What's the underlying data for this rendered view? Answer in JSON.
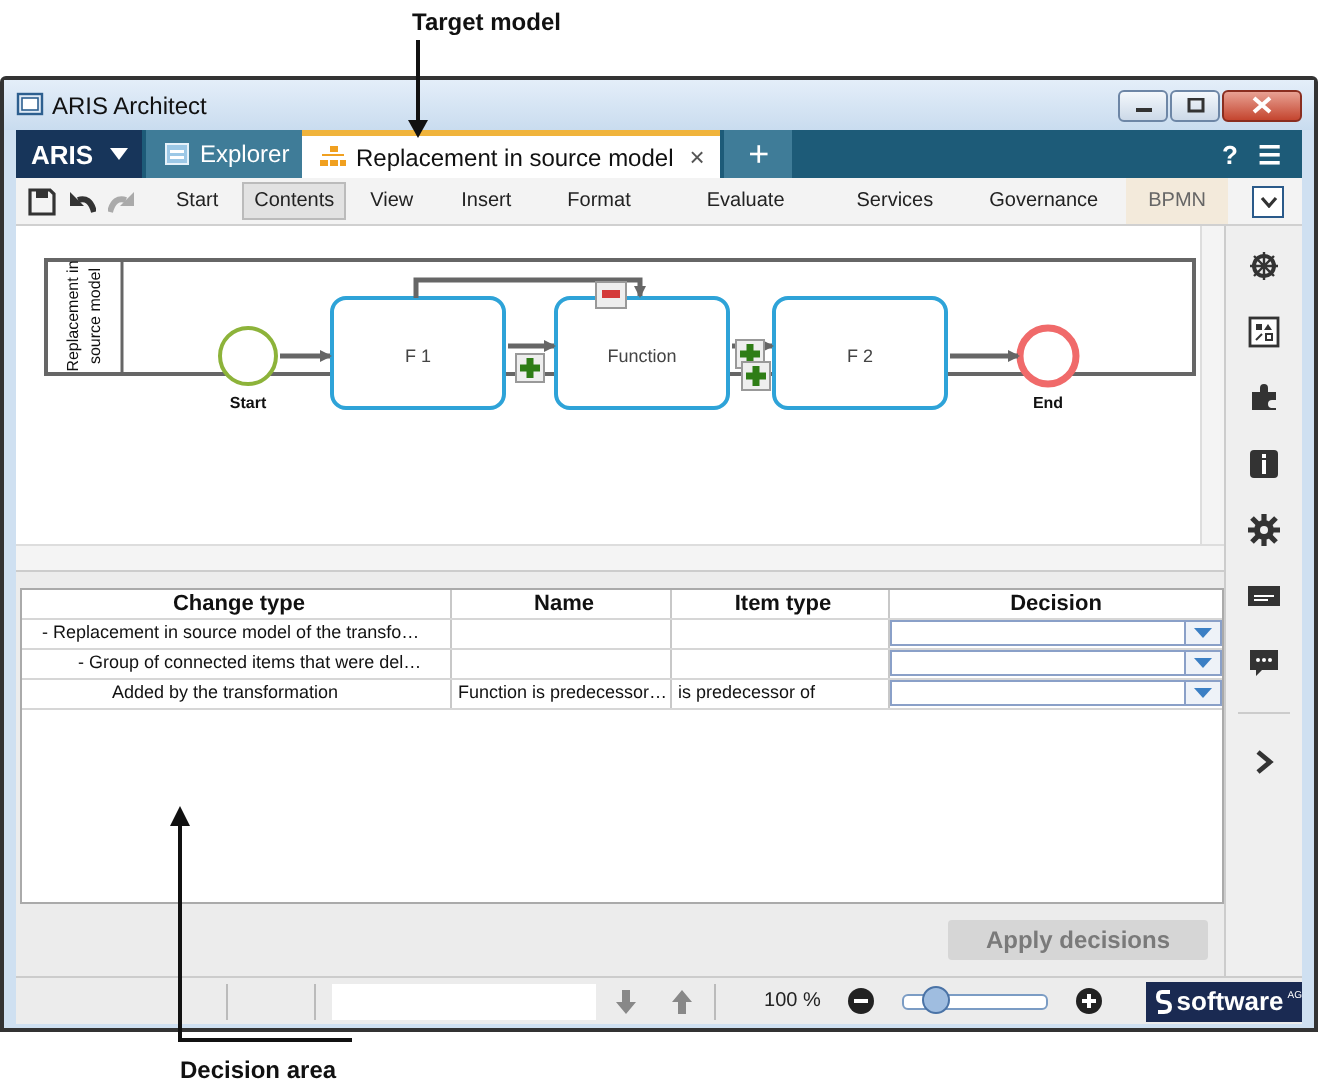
{
  "annotations": [
    {
      "kind": "top",
      "text": "Target model"
    },
    {
      "kind": "bottom",
      "text": "Decision area"
    }
  ],
  "window": {
    "title": "ARIS Architect"
  },
  "tabs": [
    {
      "kind": "menu",
      "label": "ARIS",
      "selected": false
    },
    {
      "kind": "tab",
      "label": "Explorer",
      "selected": false
    },
    {
      "kind": "tab",
      "label": "Replacement in source model",
      "selected": true,
      "close": "×"
    },
    {
      "kind": "add",
      "label": "+",
      "selected": false
    }
  ],
  "help": "?",
  "menu": "☰",
  "tools": [
    {
      "kind": "save",
      "disabled": false
    },
    {
      "kind": "undo",
      "disabled": false
    },
    {
      "kind": "redo",
      "disabled": true
    }
  ],
  "ribbon": [
    {
      "label": "Start",
      "selected": false,
      "kind": "tab"
    },
    {
      "label": "Contents",
      "selected": true,
      "kind": "tab"
    },
    {
      "label": "View",
      "selected": false,
      "kind": "tab"
    },
    {
      "label": "Insert",
      "selected": false,
      "kind": "tab"
    },
    {
      "label": "Format",
      "selected": false,
      "kind": "tab"
    },
    {
      "label": "Evaluate",
      "selected": false,
      "kind": "tab"
    },
    {
      "label": "Services",
      "selected": false,
      "kind": "tab"
    },
    {
      "label": "Governance",
      "selected": false,
      "kind": "tab"
    },
    {
      "label": "BPMN",
      "selected": false,
      "kind": "context"
    }
  ],
  "diagram": {
    "lane": "Replacement in source model",
    "nodes": [
      {
        "kind": "start",
        "label": "Start"
      },
      {
        "kind": "function",
        "label": "F 1"
      },
      {
        "kind": "function",
        "label": "Function"
      },
      {
        "kind": "function",
        "label": "F 2"
      },
      {
        "kind": "end",
        "label": "End"
      }
    ],
    "markers": [
      {
        "kind": "removed"
      },
      {
        "kind": "added"
      },
      {
        "kind": "added"
      },
      {
        "kind": "added"
      }
    ]
  },
  "table": {
    "columns": [
      "Change type",
      "Name",
      "Item type",
      "Decision"
    ],
    "rows": [
      {
        "change_type": "- Replacement in source model of the transfo…",
        "children": [
          {
            "change_type": "- Group of connected items that were del…",
            "children": [
              {
                "change_type": "Added by the transformation",
                "name": "Function is predecessor…",
                "item_type": "is predecessor of"
              }
            ]
          }
        ]
      }
    ]
  },
  "apply_button": {
    "label": "Apply decisions",
    "disabled": true
  },
  "status_bar": {
    "zoom": "100 %",
    "zoom_slider": {
      "level": 0.22
    },
    "logo": {
      "name": "software",
      "suffix": "AG"
    }
  }
}
